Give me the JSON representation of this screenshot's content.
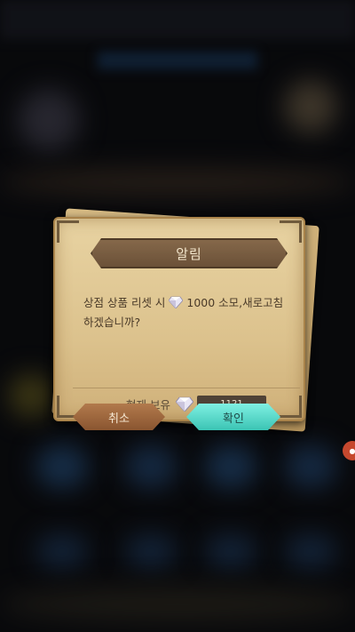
{
  "dialog": {
    "title": "알림",
    "message_prefix": "상점 상품 리셋 시",
    "message_suffix": "1000 소모,새로고침하겠습니까?",
    "holding_label": "현재 보유",
    "holding_amount": "1121",
    "cancel_label": "취소",
    "confirm_label": "확인",
    "currency_icon": "diamond-icon"
  },
  "colors": {
    "paper": "#dcc28d",
    "title_bar": "#6b5138",
    "cancel_button": "#8a5530",
    "confirm_button": "#3bc4b4",
    "text": "#4a3a28"
  }
}
